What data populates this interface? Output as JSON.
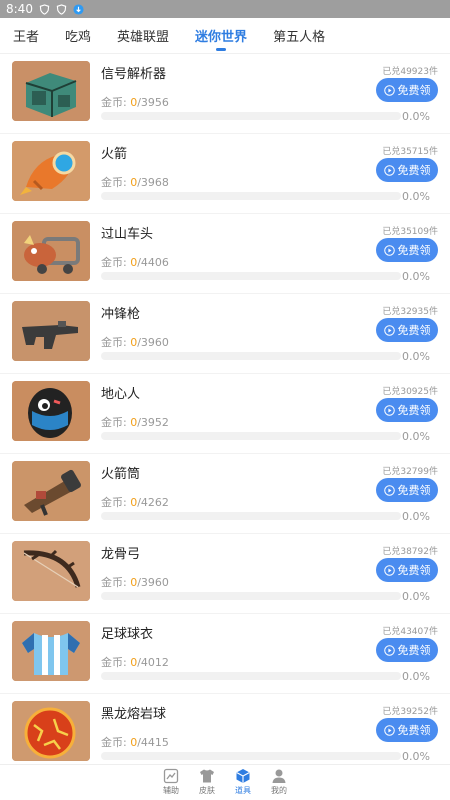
{
  "status_bar": {
    "time": "8:40"
  },
  "tabs": [
    {
      "label": "王者"
    },
    {
      "label": "吃鸡"
    },
    {
      "label": "英雄联盟"
    },
    {
      "label": "迷你世界",
      "active": true
    },
    {
      "label": "第五人格"
    }
  ],
  "item_common": {
    "coins_label": "金币: ",
    "button_label": "免费领"
  },
  "items": [
    {
      "name": "信号解析器",
      "redeemed": "已兑49923件",
      "coins_current": "0",
      "coins_total": "/3956",
      "percent": "0.0%",
      "progress": 0,
      "icon": "signal-parser-icon"
    },
    {
      "name": "火箭",
      "redeemed": "已兑35715件",
      "coins_current": "0",
      "coins_total": "/3968",
      "percent": "0.0%",
      "progress": 0,
      "icon": "rocket-icon"
    },
    {
      "name": "过山车头",
      "redeemed": "已兑35109件",
      "coins_current": "0",
      "coins_total": "/4406",
      "percent": "0.0%",
      "progress": 0,
      "icon": "coaster-head-icon"
    },
    {
      "name": "冲锋枪",
      "redeemed": "已兑32935件",
      "coins_current": "0",
      "coins_total": "/3960",
      "percent": "0.0%",
      "progress": 0,
      "icon": "smg-icon"
    },
    {
      "name": "地心人",
      "redeemed": "已兑30925件",
      "coins_current": "0",
      "coins_total": "/3952",
      "percent": "0.0%",
      "progress": 0,
      "icon": "core-man-icon"
    },
    {
      "name": "火箭筒",
      "redeemed": "已兑32799件",
      "coins_current": "0",
      "coins_total": "/4262",
      "percent": "0.0%",
      "progress": 0,
      "icon": "bazooka-icon"
    },
    {
      "name": "龙骨弓",
      "redeemed": "已兑38792件",
      "coins_current": "0",
      "coins_total": "/3960",
      "percent": "0.0%",
      "progress": 0,
      "icon": "dragon-bow-icon"
    },
    {
      "name": "足球球衣",
      "redeemed": "已兑43407件",
      "coins_current": "0",
      "coins_total": "/4012",
      "percent": "0.0%",
      "progress": 0,
      "icon": "football-jersey-icon"
    },
    {
      "name": "黑龙熔岩球",
      "redeemed": "已兑39252件",
      "coins_current": "0",
      "coins_total": "/4415",
      "percent": "0.0%",
      "progress": 0,
      "icon": "lava-ball-icon"
    }
  ],
  "bottom_nav": [
    {
      "label": "辅助",
      "icon": "chart-icon"
    },
    {
      "label": "皮肤",
      "icon": "shirt-icon"
    },
    {
      "label": "道具",
      "icon": "box-icon",
      "active": true
    },
    {
      "label": "我的",
      "icon": "user-icon"
    }
  ],
  "colors": {
    "accent": "#4a8cf0",
    "tab_active": "#2f7de1",
    "coin": "#f2a01b",
    "thumb_bg": "#c88a58"
  }
}
